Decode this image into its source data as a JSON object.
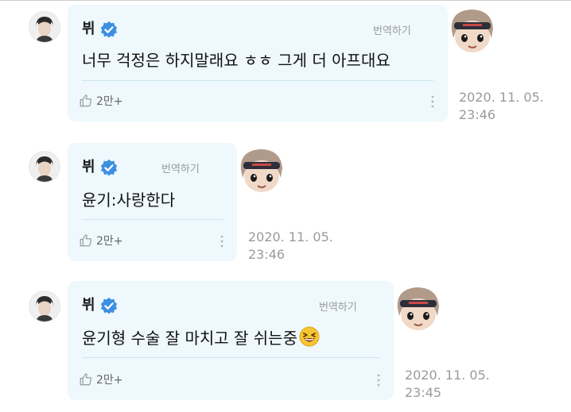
{
  "messages": [
    {
      "name": "뷔",
      "translate_label": "번역하기",
      "text": "너무 걱정은 하지말래요 ㅎㅎ 그게 더 아프대요",
      "likes": "2만+",
      "timestamp": "2020. 11. 05.\n23:46",
      "sticker_icon": "character-sticker-icon"
    },
    {
      "name": "뷔",
      "translate_label": "번역하기",
      "text": "윤기:사랑한다",
      "likes": "2만+",
      "timestamp": "2020. 11. 05.\n23:46",
      "sticker_icon": "character-sticker-icon"
    },
    {
      "name": "뷔",
      "translate_label": "번역하기",
      "text": "윤기형 수술 잘 마치고 잘 쉬는중",
      "emoji": "laughing-emoji-icon",
      "likes": "2만+",
      "timestamp": "2020. 11. 05.\n23:45",
      "sticker_icon": "character-sticker-icon"
    }
  ],
  "colors": {
    "bubble": "#eef8fd",
    "verified": "#3d8fe0",
    "meta_text": "#9a9a9a"
  }
}
